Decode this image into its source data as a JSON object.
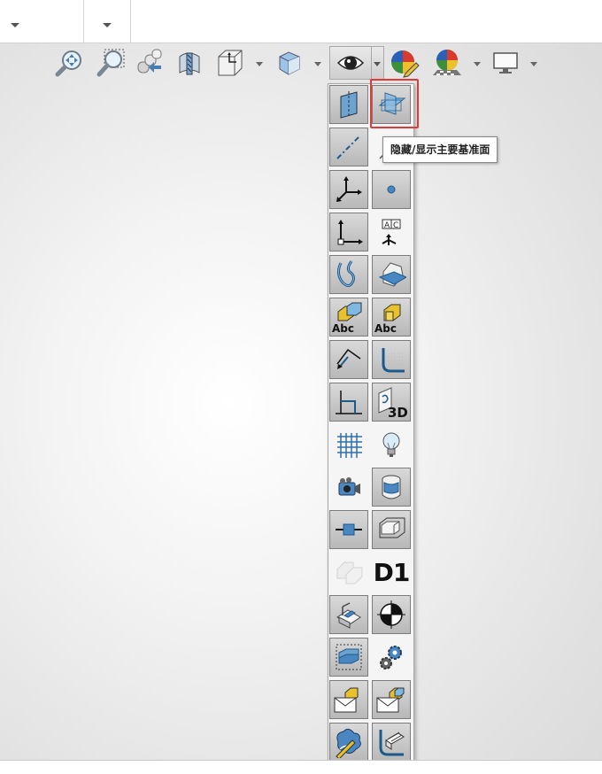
{
  "top_bar": {
    "dropdown_1": "",
    "dropdown_2": ""
  },
  "toolbar": {
    "buttons": [
      {
        "icon": "zoom-to-fit-icon"
      },
      {
        "icon": "zoom-to-area-icon"
      },
      {
        "icon": "previous-view-icon"
      },
      {
        "icon": "section-view-icon"
      },
      {
        "icon": "view-orientation-icon"
      },
      {
        "icon": "display-style-icon"
      },
      {
        "icon": "hide-show-items-icon"
      },
      {
        "icon": "edit-appearance-icon"
      },
      {
        "icon": "apply-scene-icon"
      },
      {
        "icon": "view-settings-icon"
      }
    ]
  },
  "flyout": {
    "items": [
      {
        "name": "hide-show-planes",
        "state": "on"
      },
      {
        "name": "hide-show-primary-planes",
        "state": "on",
        "highlighted": true
      },
      {
        "name": "hide-show-axes",
        "state": "on"
      },
      {
        "name": "hide-show-temporary-axes",
        "state": "off"
      },
      {
        "name": "hide-show-origins",
        "state": "on"
      },
      {
        "name": "hide-show-points",
        "state": "on"
      },
      {
        "name": "hide-show-coordinate-systems",
        "state": "on"
      },
      {
        "name": "hide-show-annotation-views",
        "state": "off"
      },
      {
        "name": "hide-show-curves",
        "state": "on"
      },
      {
        "name": "hide-show-parting-lines",
        "state": "on"
      },
      {
        "name": "hide-show-annotations",
        "state": "on"
      },
      {
        "name": "hide-show-feature-dimensions",
        "state": "on"
      },
      {
        "name": "hide-show-reference-dimensions",
        "state": "on"
      },
      {
        "name": "hide-show-weld-beads",
        "state": "on"
      },
      {
        "name": "hide-show-sketches",
        "state": "on"
      },
      {
        "name": "hide-show-3d-sketch-planes",
        "state": "on"
      },
      {
        "name": "hide-show-grid",
        "state": "off"
      },
      {
        "name": "hide-show-lights",
        "state": "off"
      },
      {
        "name": "hide-show-cameras",
        "state": "off"
      },
      {
        "name": "hide-show-decals",
        "state": "on"
      },
      {
        "name": "hide-show-sketch-relations",
        "state": "on"
      },
      {
        "name": "hide-show-bounding-box",
        "state": "on"
      },
      {
        "name": "hide-show-routing-points",
        "state": "off"
      },
      {
        "name": "hide-show-dimension-names",
        "state": "off"
      },
      {
        "name": "hide-show-weldments",
        "state": "on"
      },
      {
        "name": "hide-show-center-of-mass",
        "state": "on"
      },
      {
        "name": "hide-show-envelopes",
        "state": "on"
      },
      {
        "name": "hide-show-mate-references",
        "state": "off"
      },
      {
        "name": "hide-show-markup",
        "state": "on"
      },
      {
        "name": "hide-show-part-markup",
        "state": "on"
      },
      {
        "name": "hide-show-sketch-markup",
        "state": "on"
      },
      {
        "name": "hide-show-surface-markup",
        "state": "on"
      }
    ]
  },
  "tooltip": {
    "text": "隐藏/显示主要基准面"
  },
  "d1_label": "D1",
  "abc_label": "Abc",
  "d3_label": "3D",
  "ac_label_a": "A",
  "ac_label_c": "C"
}
